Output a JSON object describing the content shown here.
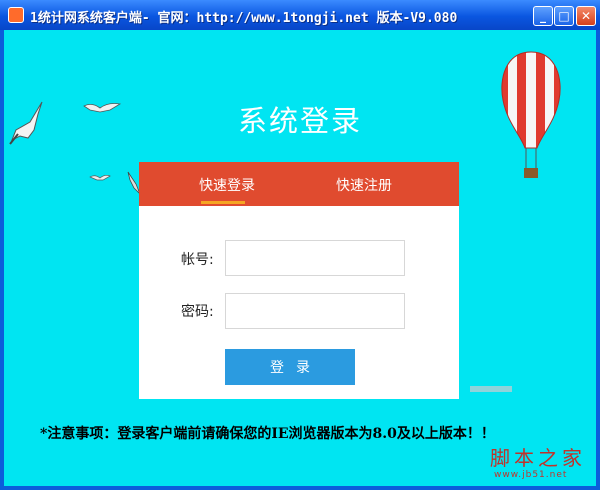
{
  "window": {
    "title": "1统计网系统客户端- 官网：http://www.1tongji.net 版本-V9.080"
  },
  "login": {
    "heading": "系统登录",
    "tabs": [
      "快速登录",
      "快速注册"
    ],
    "account_label": "帐号:",
    "password_label": "密码:",
    "account_value": "",
    "password_value": "",
    "login_button": "登录"
  },
  "notice": "*注意事项：登录客户端前请确保您的IE浏览器版本为8.0及以上版本！！",
  "watermark": {
    "text": "脚本之家",
    "sub": "www.jb51.net"
  },
  "colors": {
    "background": "#00E5F2",
    "tab_bar": "#E04B2F",
    "tab_underline": "#F5A623",
    "login_button": "#2B9BE0",
    "titlebar": "#0B5EDB"
  }
}
